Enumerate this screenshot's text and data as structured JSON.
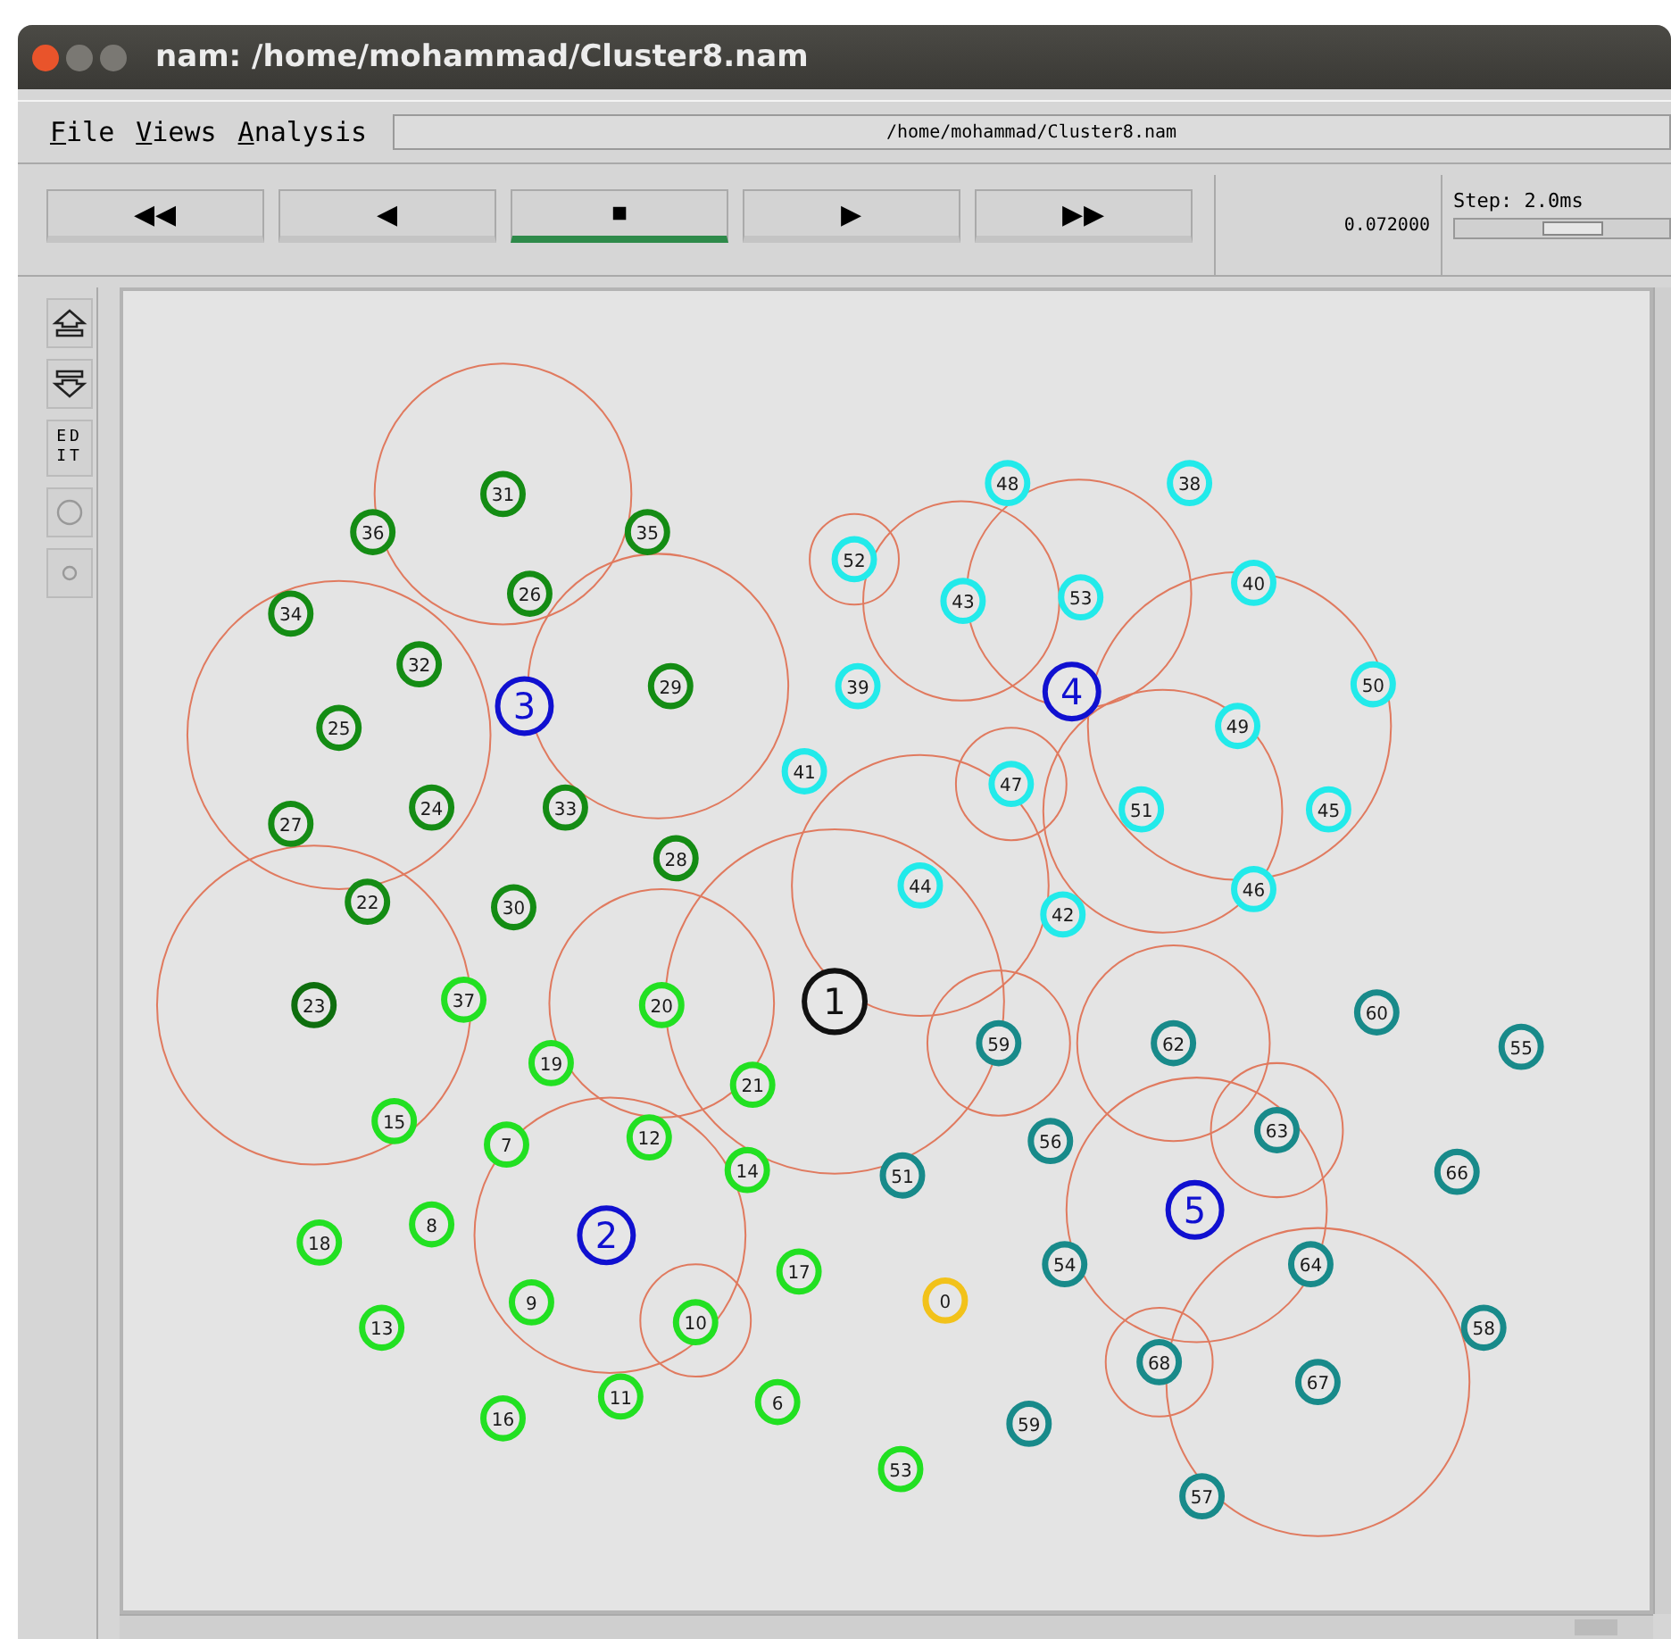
{
  "window": {
    "title": "nam: /home/mohammad/Cluster8.nam"
  },
  "menu": [
    {
      "label": "File"
    },
    {
      "label": "Views"
    },
    {
      "label": "Analysis"
    }
  ],
  "trace_file": "/home/mohammad/Cluster8.nam",
  "transport": [
    {
      "label": "◀◀",
      "selected": false
    },
    {
      "label": "◀",
      "selected": false
    },
    {
      "label": "■",
      "selected": true
    },
    {
      "label": "▶",
      "selected": false
    },
    {
      "label": "▶▶",
      "selected": false
    }
  ],
  "time": "0.072000",
  "step": {
    "label": "Step: 2.0ms",
    "level": 0.55
  },
  "tools": [
    {
      "kind": "zoom-in"
    },
    {
      "kind": "zoom-out"
    },
    {
      "kind": "edit",
      "label": "EDIT"
    },
    {
      "kind": "large-circle"
    },
    {
      "kind": "small-circle"
    }
  ],
  "nodes": [
    {
      "label": "48",
      "kind": "sensor",
      "color": "#22eaea"
    },
    {
      "label": "38",
      "kind": "sensor",
      "color": "#22eaea"
    },
    {
      "label": "31",
      "kind": "sensor",
      "color": "#148c14"
    },
    {
      "label": "36",
      "kind": "sensor",
      "color": "#148c14"
    },
    {
      "label": "35",
      "kind": "sensor",
      "color": "#148c14"
    },
    {
      "label": "52",
      "kind": "sensor",
      "color": "#22eaea"
    },
    {
      "label": "40",
      "kind": "sensor",
      "color": "#22eaea"
    },
    {
      "label": "26",
      "kind": "sensor",
      "color": "#148c14"
    },
    {
      "label": "43",
      "kind": "sensor",
      "color": "#22eaea"
    },
    {
      "label": "53",
      "kind": "sensor",
      "color": "#22eaea"
    },
    {
      "label": "34",
      "kind": "sensor",
      "color": "#148c14"
    },
    {
      "label": "32",
      "kind": "sensor",
      "color": "#148c14"
    },
    {
      "label": "3",
      "kind": "head",
      "color": "#1010d0"
    },
    {
      "label": "29",
      "kind": "sensor",
      "color": "#148c14"
    },
    {
      "label": "39",
      "kind": "sensor",
      "color": "#22eaea"
    },
    {
      "label": "4",
      "kind": "head",
      "color": "#1010d0"
    },
    {
      "label": "50",
      "kind": "sensor",
      "color": "#22eaea"
    },
    {
      "label": "25",
      "kind": "sensor",
      "color": "#148c14"
    },
    {
      "label": "49",
      "kind": "sensor",
      "color": "#22eaea"
    },
    {
      "label": "41",
      "kind": "sensor",
      "color": "#22eaea"
    },
    {
      "label": "47",
      "kind": "sensor",
      "color": "#22eaea"
    },
    {
      "label": "24",
      "kind": "sensor",
      "color": "#148c14"
    },
    {
      "label": "33",
      "kind": "sensor",
      "color": "#148c14"
    },
    {
      "label": "51",
      "kind": "sensor",
      "color": "#22eaea"
    },
    {
      "label": "45",
      "kind": "sensor",
      "color": "#22eaea"
    },
    {
      "label": "27",
      "kind": "sensor",
      "color": "#148c14"
    },
    {
      "label": "28",
      "kind": "sensor",
      "color": "#148c14"
    },
    {
      "label": "22",
      "kind": "sensor",
      "color": "#148c14"
    },
    {
      "label": "30",
      "kind": "sensor",
      "color": "#148c14"
    },
    {
      "label": "44",
      "kind": "sensor",
      "color": "#22eaea"
    },
    {
      "label": "42",
      "kind": "sensor",
      "color": "#22eaea"
    },
    {
      "label": "46",
      "kind": "sensor",
      "color": "#22eaea"
    },
    {
      "label": "23",
      "kind": "sensor",
      "color": "#0e6e0e"
    },
    {
      "label": "37",
      "kind": "sensor",
      "color": "#22e022"
    },
    {
      "label": "20",
      "kind": "sensor",
      "color": "#22e022"
    },
    {
      "label": "1",
      "kind": "base",
      "color": "#111111"
    },
    {
      "label": "60",
      "kind": "sensor",
      "color": "#188a8a"
    },
    {
      "label": "19",
      "kind": "sensor",
      "color": "#22e022"
    },
    {
      "label": "59",
      "kind": "sensor",
      "color": "#188a8a"
    },
    {
      "label": "62",
      "kind": "sensor",
      "color": "#188a8a"
    },
    {
      "label": "55",
      "kind": "sensor",
      "color": "#188a8a"
    },
    {
      "label": "21",
      "kind": "sensor",
      "color": "#22e022"
    },
    {
      "label": "15",
      "kind": "sensor",
      "color": "#22e022"
    },
    {
      "label": "7",
      "kind": "sensor",
      "color": "#22e022"
    },
    {
      "label": "12",
      "kind": "sensor",
      "color": "#22e022"
    },
    {
      "label": "56",
      "kind": "sensor",
      "color": "#188a8a"
    },
    {
      "label": "63",
      "kind": "sensor",
      "color": "#188a8a"
    },
    {
      "label": "14",
      "kind": "sensor",
      "color": "#22e022"
    },
    {
      "label": "51",
      "kind": "sensor",
      "color": "#188a8a"
    },
    {
      "label": "66",
      "kind": "sensor",
      "color": "#188a8a"
    },
    {
      "label": "5",
      "kind": "head",
      "color": "#1010d0"
    },
    {
      "label": "18",
      "kind": "sensor",
      "color": "#22e022"
    },
    {
      "label": "8",
      "kind": "sensor",
      "color": "#22e022"
    },
    {
      "label": "2",
      "kind": "head",
      "color": "#1010d0"
    },
    {
      "label": "17",
      "kind": "sensor",
      "color": "#22e022"
    },
    {
      "label": "54",
      "kind": "sensor",
      "color": "#188a8a"
    },
    {
      "label": "64",
      "kind": "sensor",
      "color": "#188a8a"
    },
    {
      "label": "13",
      "kind": "sensor",
      "color": "#22e022"
    },
    {
      "label": "9",
      "kind": "sensor",
      "color": "#22e022"
    },
    {
      "label": "10",
      "kind": "sensor",
      "color": "#22e022"
    },
    {
      "label": "0",
      "kind": "sensor",
      "color": "#f2c21a"
    },
    {
      "label": "58",
      "kind": "sensor",
      "color": "#188a8a"
    },
    {
      "label": "68",
      "kind": "sensor",
      "color": "#188a8a"
    },
    {
      "label": "67",
      "kind": "sensor",
      "color": "#188a8a"
    },
    {
      "label": "16",
      "kind": "sensor",
      "color": "#22e022"
    },
    {
      "label": "11",
      "kind": "sensor",
      "color": "#22e022"
    },
    {
      "label": "6",
      "kind": "sensor",
      "color": "#22e022"
    },
    {
      "label": "59",
      "kind": "sensor",
      "color": "#188a8a"
    },
    {
      "label": "53",
      "kind": "sensor",
      "color": "#22e022"
    },
    {
      "label": "57",
      "kind": "sensor",
      "color": "#188a8a"
    }
  ]
}
